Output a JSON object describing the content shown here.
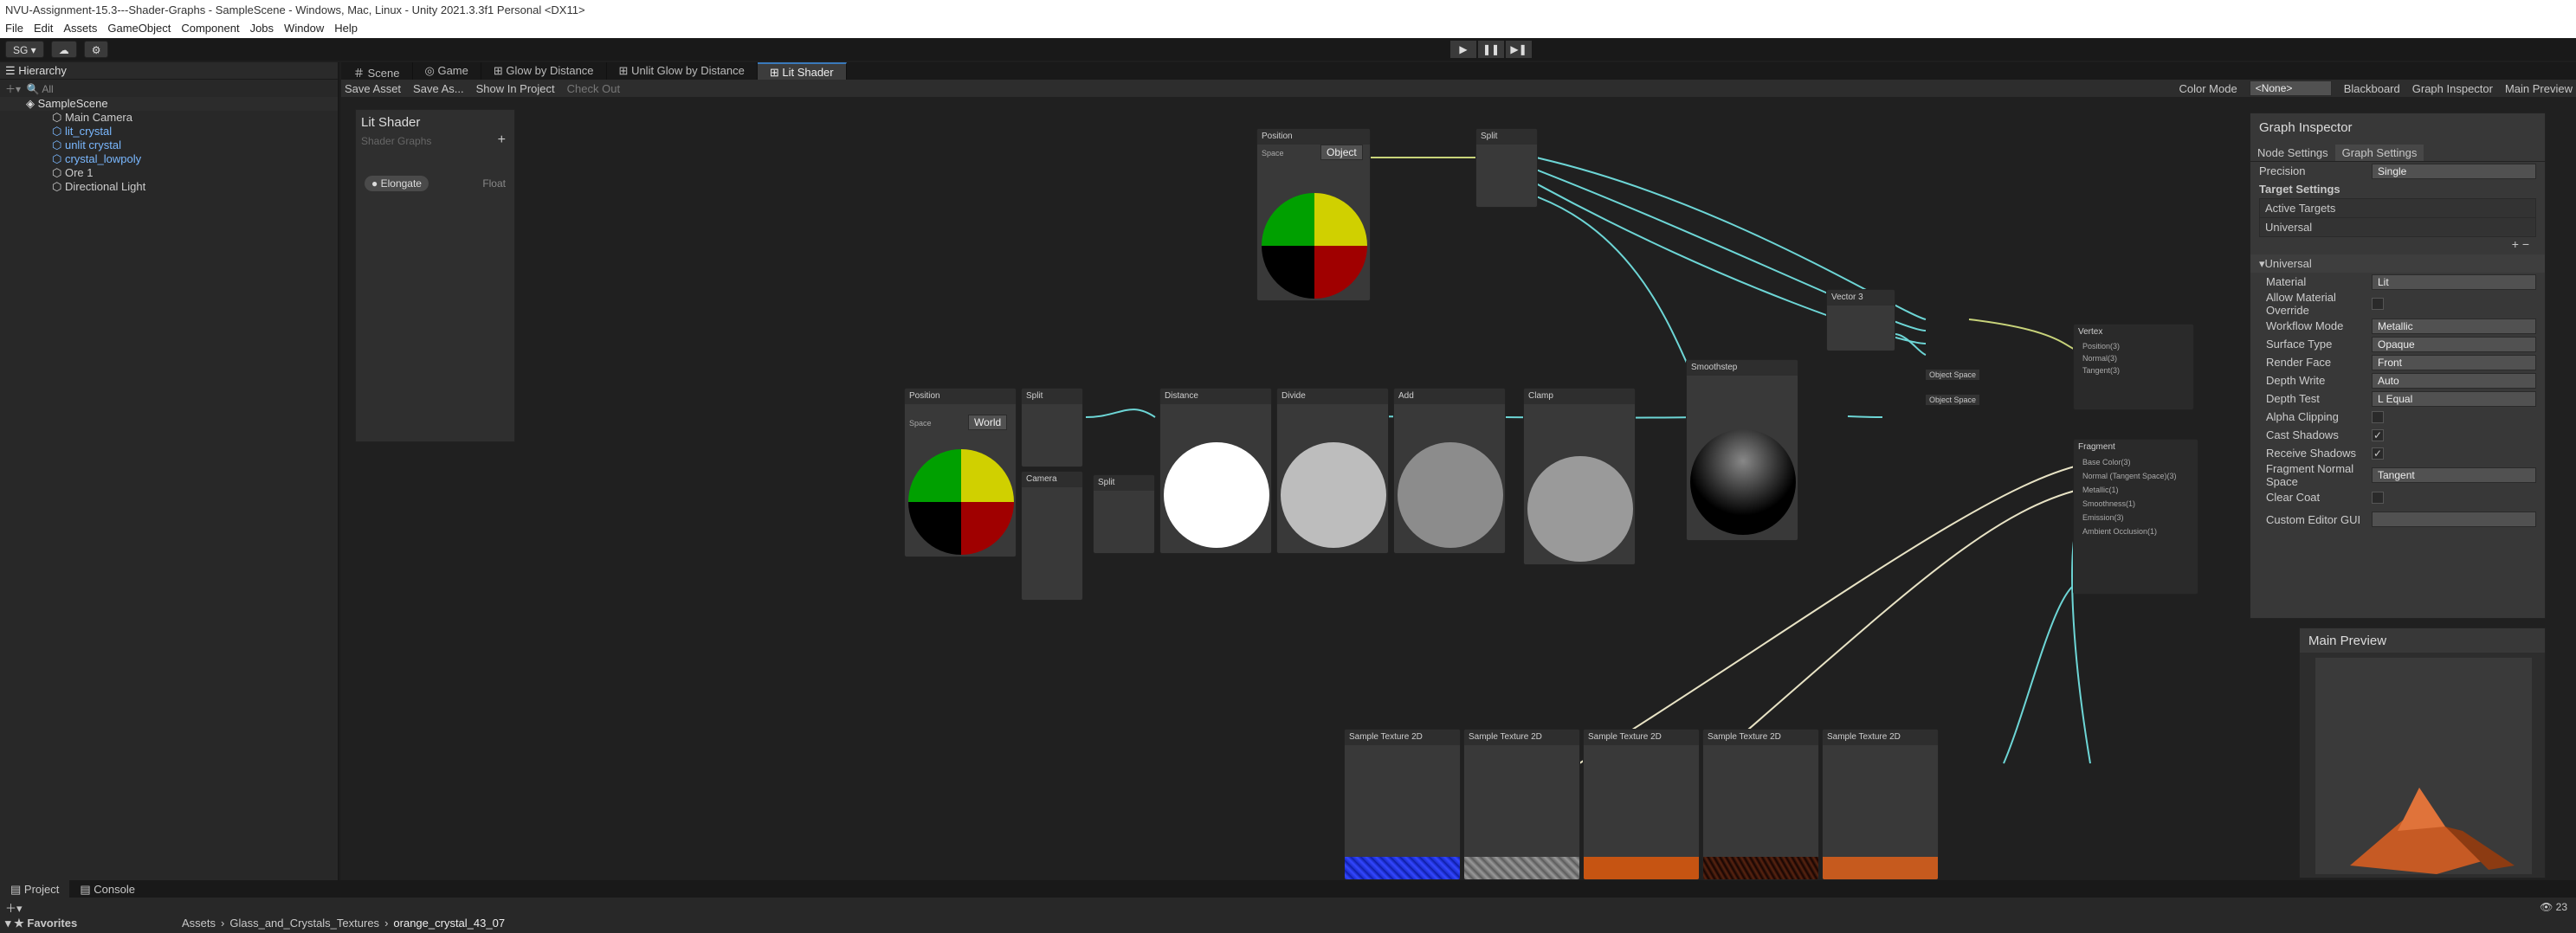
{
  "window_title": "NVU-Assignment-15.3---Shader-Graphs - SampleScene - Windows, Mac, Linux - Unity 2021.3.3f1 Personal <DX11>",
  "menu": [
    "File",
    "Edit",
    "Assets",
    "GameObject",
    "Component",
    "Jobs",
    "Window",
    "Help"
  ],
  "toolbar": {
    "account": "SG",
    "play_icons": [
      "play-icon",
      "pause-icon",
      "step-icon"
    ]
  },
  "hierarchy": {
    "title": "Hierarchy",
    "search_placeholder": "All",
    "items": [
      {
        "label": "SampleScene",
        "depth": 0,
        "color": "#dddddd"
      },
      {
        "label": "Main Camera",
        "depth": 1,
        "color": "#cccccc"
      },
      {
        "label": "lit_crystal",
        "depth": 1,
        "color": "#7ab8ff"
      },
      {
        "label": "unlit crystal",
        "depth": 1,
        "color": "#7ab8ff"
      },
      {
        "label": "crystal_lowpoly",
        "depth": 1,
        "color": "#7ab8ff"
      },
      {
        "label": "Ore 1",
        "depth": 1,
        "color": "#cccccc"
      },
      {
        "label": "Directional Light",
        "depth": 1,
        "color": "#cccccc"
      }
    ]
  },
  "editor_tabs": [
    "Scene",
    "Game",
    "Glow by Distance",
    "Unlit Glow by Distance",
    "Lit Shader"
  ],
  "shadergraph_bar": {
    "save_asset": "Save Asset",
    "save_as": "Save As...",
    "show_in_project": "Show In Project",
    "check_out": "Check Out",
    "color_mode_label": "Color Mode",
    "color_mode_value": "<None>",
    "blackboard": "Blackboard",
    "graph_inspector": "Graph Inspector",
    "main_preview": "Main Preview"
  },
  "blackboard": {
    "title": "Lit Shader",
    "subtitle": "Shader Graphs",
    "property": "Elongate",
    "property_type": "Float"
  },
  "nodes": {
    "position_top": "Position",
    "split_top": "Split",
    "vector3": "Vector 3",
    "vertex": "Vertex",
    "position_left": "Position",
    "split_left": "Split",
    "distance": "Distance",
    "divide": "Divide",
    "add": "Add",
    "clamp": "Clamp",
    "smoothstep": "Smoothstep",
    "camera": "Camera",
    "split_mid": "Split",
    "fragment": "Fragment",
    "space": "Space",
    "object": "Object",
    "world": "World",
    "sample_texture": "Sample Texture 2D",
    "vertex_ports": [
      "Position(3)",
      "Normal(3)",
      "Tangent(3)"
    ],
    "fragment_ports": [
      "Base Color(3)",
      "Normal (Tangent Space)(3)",
      "Metallic(1)",
      "Smoothness(1)",
      "Emission(3)",
      "Ambient Occlusion(1)"
    ],
    "object_space": "Object Space"
  },
  "inspector": {
    "title": "Graph Inspector",
    "tabs": [
      "Node Settings",
      "Graph Settings"
    ],
    "precision_label": "Precision",
    "precision_value": "Single",
    "target_settings": "Target Settings",
    "active_targets": "Active Targets",
    "target": "Universal",
    "section": "Universal",
    "rows": [
      {
        "label": "Material",
        "value": "Lit",
        "kind": "dd"
      },
      {
        "label": "Allow Material Override",
        "value": "",
        "kind": "chk"
      },
      {
        "label": "Workflow Mode",
        "value": "Metallic",
        "kind": "dd"
      },
      {
        "label": "Surface Type",
        "value": "Opaque",
        "kind": "dd"
      },
      {
        "label": "Render Face",
        "value": "Front",
        "kind": "dd"
      },
      {
        "label": "Depth Write",
        "value": "Auto",
        "kind": "dd"
      },
      {
        "label": "Depth Test",
        "value": "L Equal",
        "kind": "dd"
      },
      {
        "label": "Alpha Clipping",
        "value": "",
        "kind": "chk"
      },
      {
        "label": "Cast Shadows",
        "value": "✓",
        "kind": "chk"
      },
      {
        "label": "Receive Shadows",
        "value": "✓",
        "kind": "chk"
      },
      {
        "label": "Fragment Normal Space",
        "value": "Tangent",
        "kind": "dd"
      },
      {
        "label": "Clear Coat",
        "value": "",
        "kind": "chk"
      },
      {
        "label": "Custom Editor GUI",
        "value": "",
        "kind": "dd"
      }
    ]
  },
  "main_preview": {
    "title": "Main Preview"
  },
  "bottom": {
    "tabs": [
      "Project",
      "Console"
    ],
    "favorites": "Favorites",
    "breadcrumb": [
      "Assets",
      "Glass_and_Crystals_Textures",
      "orange_crystal_43_07"
    ],
    "count": "23"
  }
}
